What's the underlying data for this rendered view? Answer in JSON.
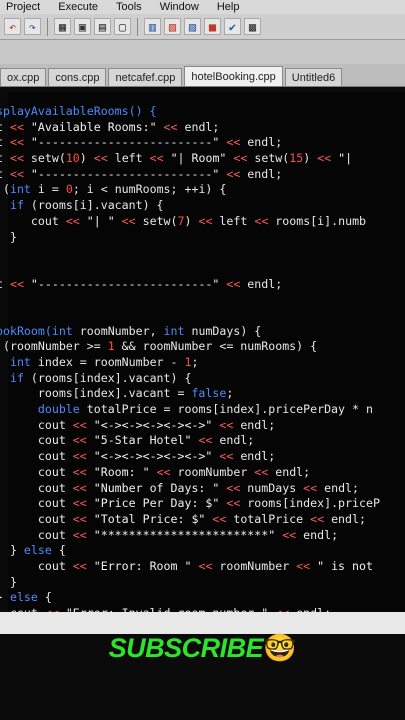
{
  "menu": {
    "items": [
      "Project",
      "Execute",
      "Tools",
      "Window",
      "Help"
    ]
  },
  "toolbar": {
    "icons": [
      "undo-icon",
      "redo-icon",
      "compile-icon",
      "run-icon",
      "save-icon",
      "new-icon",
      "grid-icon",
      "stop-icon",
      "check-icon"
    ]
  },
  "tabs": [
    {
      "label": "ox.cpp"
    },
    {
      "label": "cons.cpp"
    },
    {
      "label": "netcafef.cpp"
    },
    {
      "label": "hotelBooking.cpp"
    },
    {
      "label": "Untitled6"
    }
  ],
  "code": {
    "lines": [
      [
        {
          "c": "k",
          "t": "splayAvailableRooms() {"
        }
      ],
      [
        {
          "c": "v",
          "t": "t "
        },
        {
          "c": "o",
          "t": "<<"
        },
        {
          "c": "s",
          "t": " \"Available Rooms:\" "
        },
        {
          "c": "o",
          "t": "<<"
        },
        {
          "c": "v",
          "t": " endl;"
        }
      ],
      [
        {
          "c": "v",
          "t": "t "
        },
        {
          "c": "o",
          "t": "<<"
        },
        {
          "c": "s",
          "t": " \"-------------------------\" "
        },
        {
          "c": "o",
          "t": "<<"
        },
        {
          "c": "v",
          "t": " endl;"
        }
      ],
      [
        {
          "c": "v",
          "t": "t "
        },
        {
          "c": "o",
          "t": "<<"
        },
        {
          "c": "v",
          "t": " setw("
        },
        {
          "c": "n",
          "t": "10"
        },
        {
          "c": "v",
          "t": ") "
        },
        {
          "c": "o",
          "t": "<<"
        },
        {
          "c": "v",
          "t": " left "
        },
        {
          "c": "o",
          "t": "<<"
        },
        {
          "c": "s",
          "t": " \"| Room\" "
        },
        {
          "c": "o",
          "t": "<<"
        },
        {
          "c": "v",
          "t": " setw("
        },
        {
          "c": "n",
          "t": "15"
        },
        {
          "c": "v",
          "t": ") "
        },
        {
          "c": "o",
          "t": "<<"
        },
        {
          "c": "s",
          "t": " \"|"
        }
      ],
      [
        {
          "c": "v",
          "t": "t "
        },
        {
          "c": "o",
          "t": "<<"
        },
        {
          "c": "s",
          "t": " \"-------------------------\" "
        },
        {
          "c": "o",
          "t": "<<"
        },
        {
          "c": "v",
          "t": " endl;"
        }
      ],
      [
        {
          "c": "v",
          "t": " ("
        },
        {
          "c": "k",
          "t": "int"
        },
        {
          "c": "v",
          "t": " i = "
        },
        {
          "c": "n",
          "t": "0"
        },
        {
          "c": "v",
          "t": "; i < numRooms; ++i) {"
        }
      ],
      [
        {
          "c": "v",
          "t": "  "
        },
        {
          "c": "k",
          "t": "if"
        },
        {
          "c": "v",
          "t": " (rooms[i].vacant) {"
        }
      ],
      [
        {
          "c": "v",
          "t": "     cout "
        },
        {
          "c": "o",
          "t": "<<"
        },
        {
          "c": "s",
          "t": " \"| \" "
        },
        {
          "c": "o",
          "t": "<<"
        },
        {
          "c": "v",
          "t": " setw("
        },
        {
          "c": "n",
          "t": "7"
        },
        {
          "c": "v",
          "t": ") "
        },
        {
          "c": "o",
          "t": "<<"
        },
        {
          "c": "v",
          "t": " left "
        },
        {
          "c": "o",
          "t": "<<"
        },
        {
          "c": "v",
          "t": " rooms[i].numb"
        }
      ],
      [
        {
          "c": "v",
          "t": "  }"
        }
      ],
      [
        {
          "c": "v",
          "t": ""
        }
      ],
      [
        {
          "c": "v",
          "t": ""
        }
      ],
      [
        {
          "c": "v",
          "t": "t "
        },
        {
          "c": "o",
          "t": "<<"
        },
        {
          "c": "s",
          "t": " \"-------------------------\" "
        },
        {
          "c": "o",
          "t": "<<"
        },
        {
          "c": "v",
          "t": " endl;"
        }
      ],
      [
        {
          "c": "v",
          "t": ""
        }
      ],
      [
        {
          "c": "v",
          "t": ""
        }
      ],
      [
        {
          "c": "k",
          "t": "ookRoom("
        },
        {
          "c": "k",
          "t": "int"
        },
        {
          "c": "v",
          "t": " roomNumber, "
        },
        {
          "c": "k",
          "t": "int"
        },
        {
          "c": "v",
          "t": " numDays) {"
        }
      ],
      [
        {
          "c": "v",
          "t": " (roomNumber >= "
        },
        {
          "c": "n",
          "t": "1"
        },
        {
          "c": "v",
          "t": " && roomNumber <= numRooms) {"
        }
      ],
      [
        {
          "c": "v",
          "t": "  "
        },
        {
          "c": "k",
          "t": "int"
        },
        {
          "c": "v",
          "t": " index = roomNumber - "
        },
        {
          "c": "n",
          "t": "1"
        },
        {
          "c": "v",
          "t": ";"
        }
      ],
      [
        {
          "c": "v",
          "t": "  "
        },
        {
          "c": "k",
          "t": "if"
        },
        {
          "c": "v",
          "t": " (rooms[index].vacant) {"
        }
      ],
      [
        {
          "c": "v",
          "t": "      rooms[index].vacant = "
        },
        {
          "c": "k",
          "t": "false"
        },
        {
          "c": "v",
          "t": ";"
        }
      ],
      [
        {
          "c": "v",
          "t": "      "
        },
        {
          "c": "k",
          "t": "double"
        },
        {
          "c": "v",
          "t": " totalPrice = rooms[index].pricePerDay * n"
        }
      ],
      [
        {
          "c": "v",
          "t": "      cout "
        },
        {
          "c": "o",
          "t": "<<"
        },
        {
          "c": "s",
          "t": " \"<-><-><-><-><->\" "
        },
        {
          "c": "o",
          "t": "<<"
        },
        {
          "c": "v",
          "t": " endl;"
        }
      ],
      [
        {
          "c": "v",
          "t": "      cout "
        },
        {
          "c": "o",
          "t": "<<"
        },
        {
          "c": "s",
          "t": " \"5-Star Hotel\" "
        },
        {
          "c": "o",
          "t": "<<"
        },
        {
          "c": "v",
          "t": " endl;"
        }
      ],
      [
        {
          "c": "v",
          "t": "      cout "
        },
        {
          "c": "o",
          "t": "<<"
        },
        {
          "c": "s",
          "t": " \"<-><-><-><-><->\" "
        },
        {
          "c": "o",
          "t": "<<"
        },
        {
          "c": "v",
          "t": " endl;"
        }
      ],
      [
        {
          "c": "v",
          "t": "      cout "
        },
        {
          "c": "o",
          "t": "<<"
        },
        {
          "c": "s",
          "t": " \"Room: \" "
        },
        {
          "c": "o",
          "t": "<<"
        },
        {
          "c": "v",
          "t": " roomNumber "
        },
        {
          "c": "o",
          "t": "<<"
        },
        {
          "c": "v",
          "t": " endl;"
        }
      ],
      [
        {
          "c": "v",
          "t": "      cout "
        },
        {
          "c": "o",
          "t": "<<"
        },
        {
          "c": "s",
          "t": " \"Number of Days: \" "
        },
        {
          "c": "o",
          "t": "<<"
        },
        {
          "c": "v",
          "t": " numDays "
        },
        {
          "c": "o",
          "t": "<<"
        },
        {
          "c": "v",
          "t": " endl;"
        }
      ],
      [
        {
          "c": "v",
          "t": "      cout "
        },
        {
          "c": "o",
          "t": "<<"
        },
        {
          "c": "s",
          "t": " \"Price Per Day: $\" "
        },
        {
          "c": "o",
          "t": "<<"
        },
        {
          "c": "v",
          "t": " rooms[index].priceP"
        }
      ],
      [
        {
          "c": "v",
          "t": "      cout "
        },
        {
          "c": "o",
          "t": "<<"
        },
        {
          "c": "s",
          "t": " \"Total Price: $\" "
        },
        {
          "c": "o",
          "t": "<<"
        },
        {
          "c": "v",
          "t": " totalPrice "
        },
        {
          "c": "o",
          "t": "<<"
        },
        {
          "c": "v",
          "t": " endl;"
        }
      ],
      [
        {
          "c": "v",
          "t": "      cout "
        },
        {
          "c": "o",
          "t": "<<"
        },
        {
          "c": "s",
          "t": " \"************************\" "
        },
        {
          "c": "o",
          "t": "<<"
        },
        {
          "c": "v",
          "t": " endl;"
        }
      ],
      [
        {
          "c": "v",
          "t": "  } "
        },
        {
          "c": "k",
          "t": "else"
        },
        {
          "c": "v",
          "t": " {"
        }
      ],
      [
        {
          "c": "v",
          "t": "      cout "
        },
        {
          "c": "o",
          "t": "<<"
        },
        {
          "c": "s",
          "t": " \"Error: Room \" "
        },
        {
          "c": "o",
          "t": "<<"
        },
        {
          "c": "v",
          "t": " roomNumber "
        },
        {
          "c": "o",
          "t": "<<"
        },
        {
          "c": "s",
          "t": " \" is not"
        }
      ],
      [
        {
          "c": "v",
          "t": "  }"
        }
      ],
      [
        {
          "c": "v",
          "t": "} "
        },
        {
          "c": "k",
          "t": "else"
        },
        {
          "c": "v",
          "t": " {"
        }
      ],
      [
        {
          "c": "v",
          "t": "  cout "
        },
        {
          "c": "o",
          "t": "<<"
        },
        {
          "c": "s",
          "t": " \"Error: Invalid room number.\" "
        },
        {
          "c": "o",
          "t": "<<"
        },
        {
          "c": "v",
          "t": " endl;"
        }
      ]
    ]
  },
  "overlay": {
    "subscribe_text": "SUBSCRIBE",
    "emoji": "🤓"
  },
  "colors": {
    "keyword": "#4d8bff",
    "number": "#ff4b4b",
    "operator": "#ff5a5a",
    "background": "#050505",
    "subscribe": "#2ee32e"
  }
}
